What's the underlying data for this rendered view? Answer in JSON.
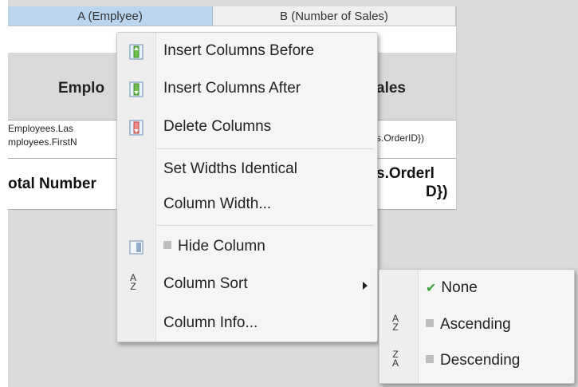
{
  "columns": {
    "a_header": "A (Emplyee)",
    "b_header": "B (Number of Sales)"
  },
  "report": {
    "employee_heading": "Emplo",
    "sales_heading": "ales",
    "field_last": "Employees.Las",
    "field_first": "mployees.FirstN",
    "orders_field": "s.OrderID})",
    "total_label": "otal Number",
    "total_value_1": "s.Orderl",
    "total_value_2": "D})"
  },
  "context_menu": {
    "items": [
      {
        "label": "Insert Columns Before",
        "icon": "insert-before-icon"
      },
      {
        "label": "Insert Columns After",
        "icon": "insert-after-icon"
      },
      {
        "label": "Delete Columns",
        "icon": "delete-column-icon"
      },
      {
        "label": "Set Widths Identical"
      },
      {
        "label": "Column Width..."
      },
      {
        "label": "Hide Column",
        "icon": "hide-column-icon"
      },
      {
        "label": "Column Sort",
        "icon": "sort-icon",
        "submenu": true
      },
      {
        "label": "Column Info..."
      }
    ]
  },
  "sort_submenu": {
    "items": [
      {
        "label": "None",
        "checked": true
      },
      {
        "label": "Ascending",
        "icon": "sort-ascending-icon"
      },
      {
        "label": "Descending",
        "icon": "sort-descending-icon"
      }
    ]
  },
  "colors": {
    "selected_header": "#bcd5ee",
    "check": "#3ba23b",
    "menu_bg": "#f5f5f5"
  }
}
